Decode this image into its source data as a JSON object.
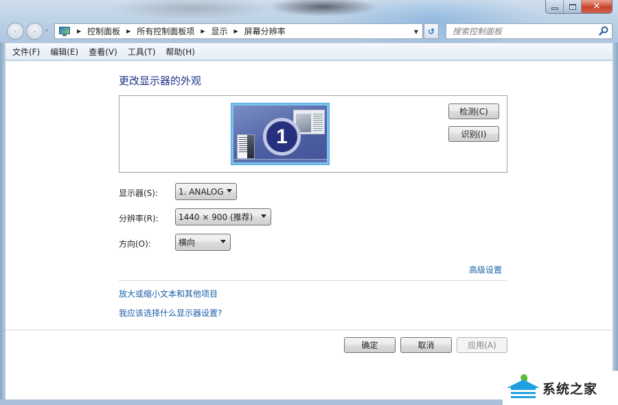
{
  "window": {
    "caption_buttons": {
      "minimize": "minimize",
      "maximize": "maximize",
      "close": "✕"
    }
  },
  "navigation": {
    "back_icon": "‹",
    "forward_icon": "›",
    "history_icon": "▾",
    "breadcrumb": [
      "控制面板",
      "所有控制面板项",
      "显示",
      "屏幕分辨率"
    ],
    "separator": "▶",
    "address_dropdown_icon": "▼",
    "refresh_icon": "↺",
    "search_placeholder": "搜索控制面板",
    "search_value": ""
  },
  "menubar": {
    "items": [
      {
        "label": "文件(F)"
      },
      {
        "label": "编辑(E)"
      },
      {
        "label": "查看(V)"
      },
      {
        "label": "工具(T)"
      },
      {
        "label": "帮助(H)"
      }
    ]
  },
  "main": {
    "title": "更改显示器的外观",
    "preview": {
      "monitor_number": "1",
      "detect_label": "检测(C)",
      "identify_label": "识别(I)"
    },
    "form": {
      "display_label": "显示器(S):",
      "display_value": "1. ANALOG",
      "resolution_label": "分辨率(R):",
      "resolution_value": "1440 × 900 (推荐)",
      "orientation_label": "方向(O):",
      "orientation_value": "横向"
    },
    "advanced_link": "高级设置",
    "links": [
      {
        "label": "放大或缩小文本和其他项目"
      },
      {
        "label": "我应该选择什么显示器设置?"
      }
    ]
  },
  "footer": {
    "ok_label": "确定",
    "cancel_label": "取消",
    "apply_label": "应用(A)"
  },
  "watermark": {
    "text": "系统之家"
  },
  "colors": {
    "link": "#1a5ea6",
    "title": "#1e3287",
    "monitor_badge": "#26307f",
    "close_button": "#c7452c"
  }
}
